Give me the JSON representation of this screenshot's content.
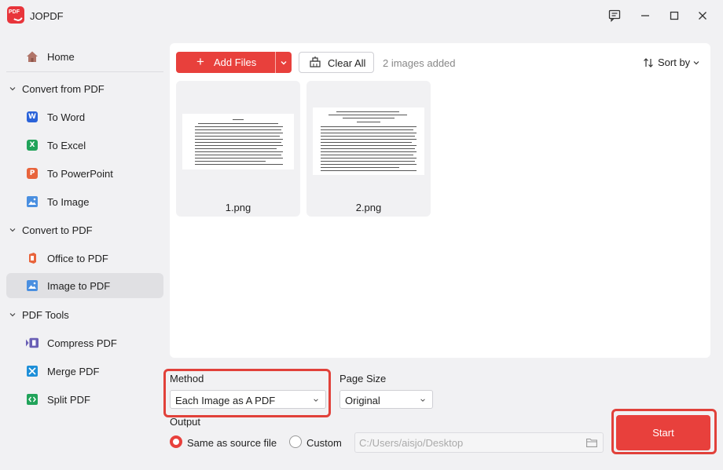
{
  "window": {
    "title": "JOPDF",
    "logo_text": "PDF"
  },
  "sidebar": {
    "home": "Home",
    "sections": [
      {
        "label": "Convert from PDF",
        "items": [
          "To Word",
          "To Excel",
          "To PowerPoint",
          "To Image"
        ]
      },
      {
        "label": "Convert to PDF",
        "items": [
          "Office to PDF",
          "Image to PDF"
        ]
      },
      {
        "label": "PDF Tools",
        "items": [
          "Compress PDF",
          "Merge PDF",
          "Split PDF"
        ]
      }
    ],
    "active_item": "Image to PDF",
    "icon_letters": {
      "word": "W",
      "excel": "X",
      "powerpoint": "P"
    }
  },
  "toolbar": {
    "add_files": "Add Files",
    "clear_all": "Clear All",
    "count": "2 images added",
    "sort_by": "Sort by"
  },
  "files": [
    {
      "name": "1.png"
    },
    {
      "name": "2.png"
    }
  ],
  "options": {
    "method_label": "Method",
    "method_value": "Each Image as A PDF",
    "page_size_label": "Page Size",
    "page_size_value": "Original",
    "output_label": "Output",
    "output_same": "Same as source file",
    "output_custom": "Custom",
    "output_path": "C:/Users/aisjo/Desktop",
    "selected_output": "Same as source file"
  },
  "start_label": "Start",
  "colors": {
    "accent": "#e8403c",
    "highlight": "#e1413a",
    "word": "#2b63d9",
    "excel": "#21a35a",
    "powerpoint": "#e8643c",
    "image": "#4a8fe0"
  }
}
